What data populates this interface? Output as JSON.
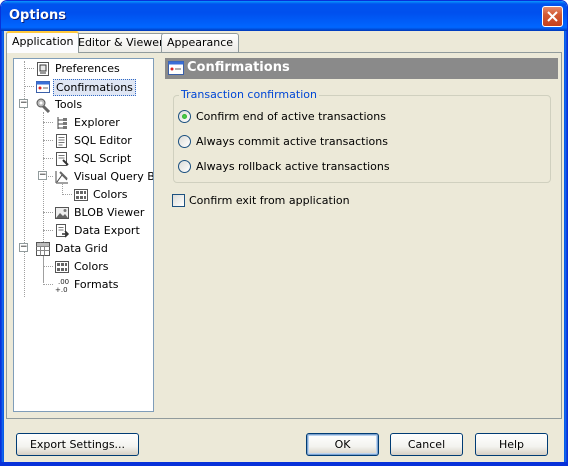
{
  "window": {
    "title": "Options"
  },
  "tabs": [
    {
      "label": "Application",
      "active": true
    },
    {
      "label": "Editor & Viewers",
      "active": false
    },
    {
      "label": "Appearance",
      "active": false
    }
  ],
  "tree": {
    "items": [
      {
        "label": "Preferences",
        "icon": "preferences-icon"
      },
      {
        "label": "Confirmations",
        "icon": "confirmations-icon",
        "selected": true
      },
      {
        "label": "Tools",
        "icon": "tools-icon",
        "expanded": true
      },
      {
        "label": "Explorer",
        "icon": "explorer-icon"
      },
      {
        "label": "SQL Editor",
        "icon": "sql-editor-icon"
      },
      {
        "label": "SQL Script",
        "icon": "sql-script-icon"
      },
      {
        "label": "Visual Query Buil",
        "icon": "visual-query-builder-icon",
        "expanded": true
      },
      {
        "label": "Colors",
        "icon": "colors-icon"
      },
      {
        "label": "BLOB Viewer",
        "icon": "blob-viewer-icon"
      },
      {
        "label": "Data Export",
        "icon": "data-export-icon"
      },
      {
        "label": "Data Grid",
        "icon": "data-grid-icon",
        "expanded": true
      },
      {
        "label": "Colors",
        "icon": "colors-icon"
      },
      {
        "label": "Formats",
        "icon": "formats-icon"
      }
    ]
  },
  "section": {
    "title": "Confirmations"
  },
  "transaction_group": {
    "legend": "Transaction confirmation",
    "options": [
      {
        "label": "Confirm end of active transactions",
        "checked": true
      },
      {
        "label": "Always commit active transactions",
        "checked": false
      },
      {
        "label": "Always rollback active transactions",
        "checked": false
      }
    ]
  },
  "confirm_exit": {
    "label": "Confirm exit from application",
    "checked": false
  },
  "buttons": {
    "export": "Export Settings...",
    "ok": "OK",
    "cancel": "Cancel",
    "help": "Help"
  },
  "colors": {
    "title_bar": "#0055e5",
    "dialog_bg": "#ece9d8",
    "section_header_bg": "#8a8a8a",
    "group_legend": "#0046d5"
  }
}
